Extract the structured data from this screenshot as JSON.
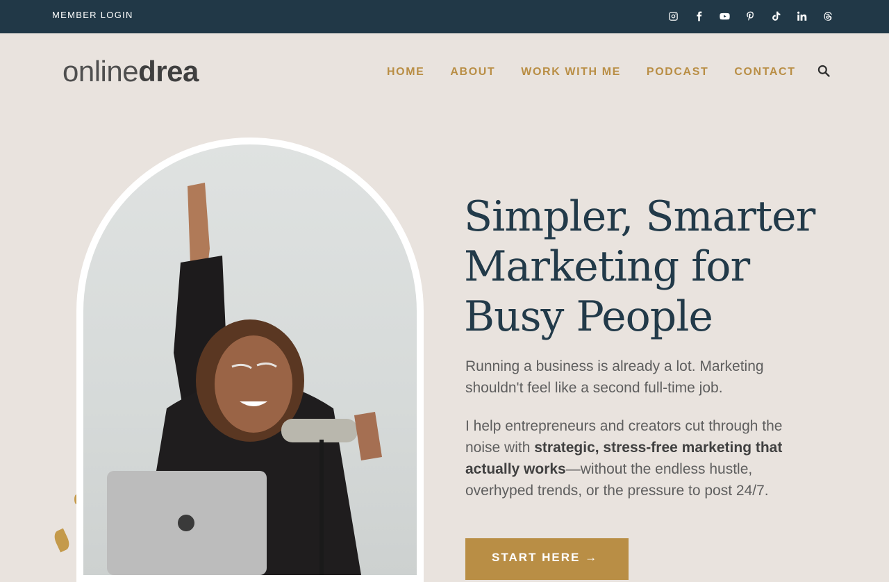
{
  "topbar": {
    "member_login": "MEMBER LOGIN",
    "socials": [
      "instagram-icon",
      "facebook-icon",
      "youtube-icon",
      "pinterest-icon",
      "tiktok-icon",
      "linkedin-icon",
      "threads-icon"
    ]
  },
  "header": {
    "logo_light": "online",
    "logo_bold": "drea",
    "nav": [
      "HOME",
      "ABOUT",
      "WORK WITH ME",
      "PODCAST",
      "CONTACT"
    ],
    "search_icon": "search-icon"
  },
  "hero": {
    "title": "Simpler, Smarter Marketing for Busy People",
    "p1": "Running a business is already a lot. Marketing shouldn't feel like a second full-time job.",
    "p2_before": "I help entrepreneurs and creators cut through the noise with ",
    "p2_bold": "strategic, stress-free marketing that actually works",
    "p2_after": "—without the endless hustle, overhyped trends, or the pressure to post 24/7.",
    "cta": "START HERE →"
  },
  "colors": {
    "topbar": "#213847",
    "accent": "#b98e45",
    "background": "#e9e3de",
    "heading": "#223a49"
  }
}
